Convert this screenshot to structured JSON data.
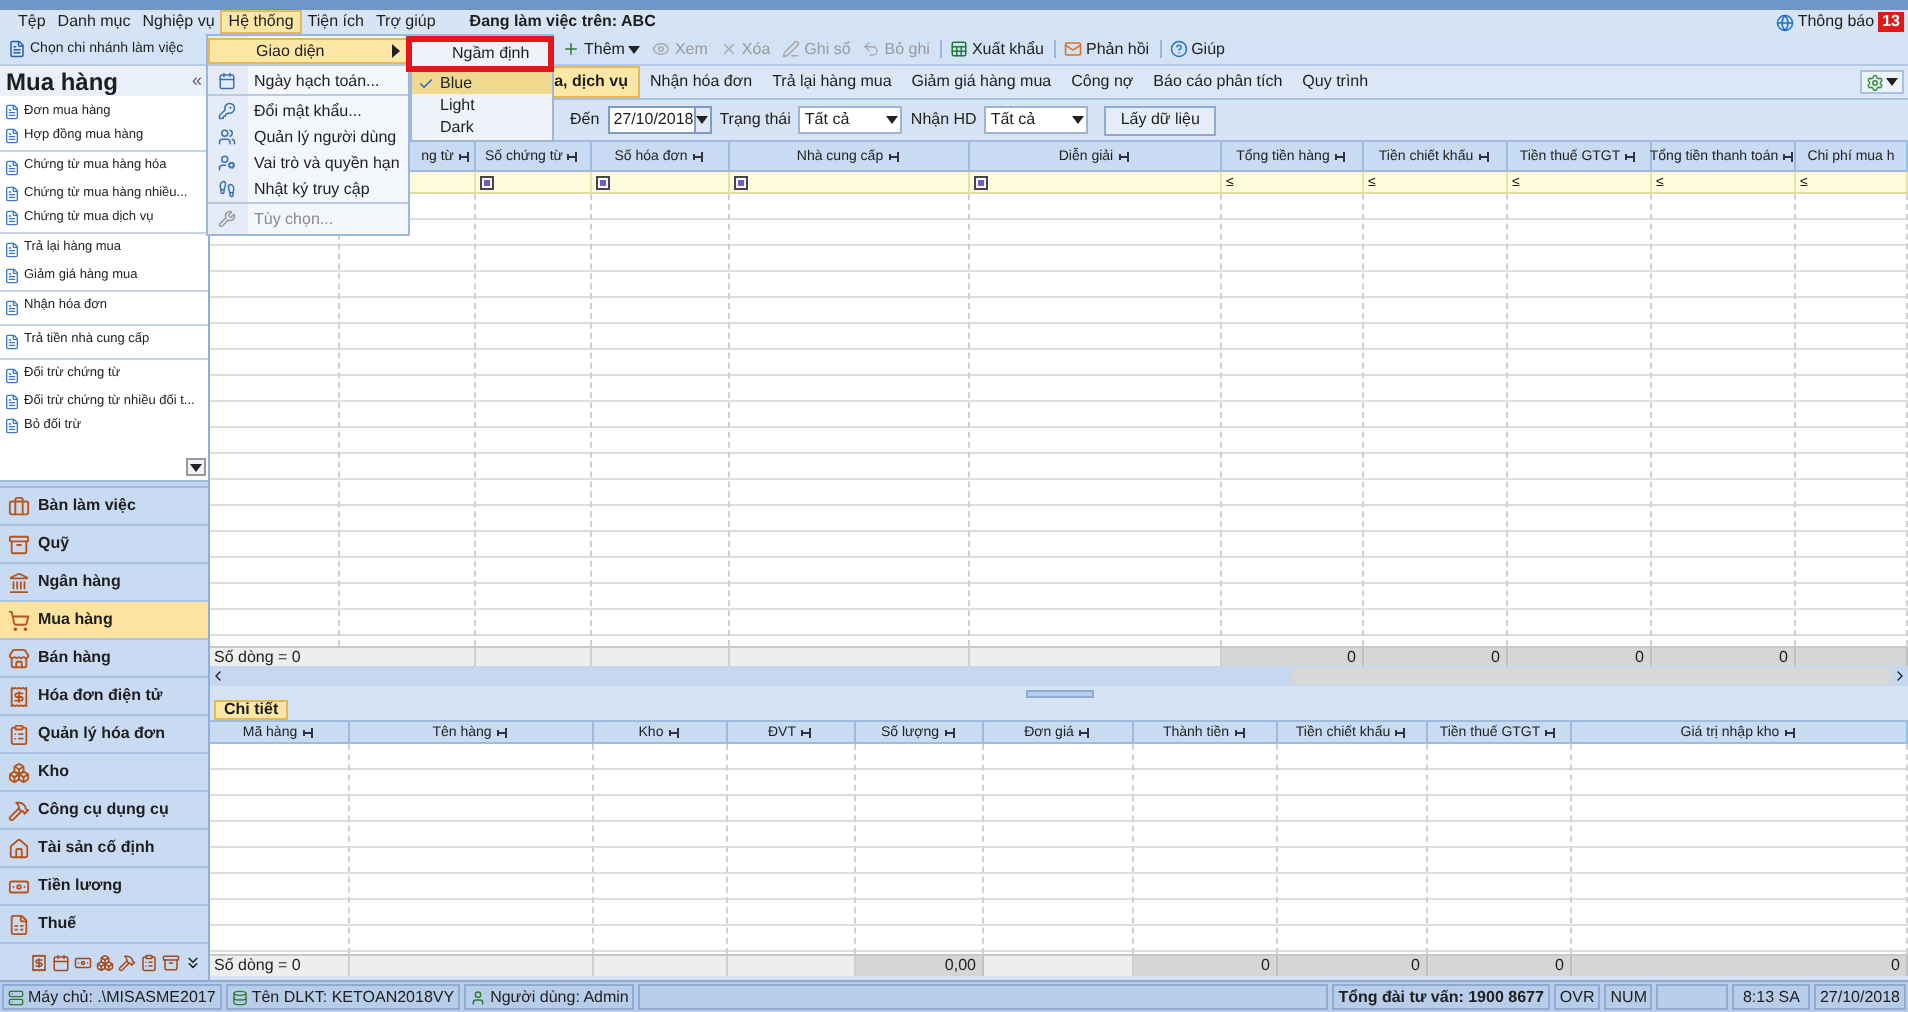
{
  "menu_bar": {
    "items": [
      {
        "label": "Tệp",
        "selected": false
      },
      {
        "label": "Danh mục",
        "selected": false
      },
      {
        "label": "Nghiệp vụ",
        "selected": false
      },
      {
        "label": "Hệ thống",
        "selected": true
      },
      {
        "label": "Tiện ích",
        "selected": false
      },
      {
        "label": "Trợ giúp",
        "selected": false
      }
    ],
    "workspace": "Đang làm việc trên: ABC",
    "notifications": {
      "label": "Thông báo",
      "count": "13"
    }
  },
  "toolbar": {
    "branch": {
      "label": "Chọn chi nhánh làm việc"
    },
    "items": [
      {
        "label": "Thêm",
        "disabled": false,
        "dropdown": true,
        "separator_before": false
      },
      {
        "label": "Xem",
        "disabled": true,
        "dropdown": false,
        "separator_before": false
      },
      {
        "label": "Xóa",
        "disabled": true,
        "dropdown": false,
        "separator_before": false
      },
      {
        "label": "Ghi sổ",
        "disabled": true,
        "dropdown": false,
        "separator_before": false
      },
      {
        "label": "Bỏ ghi",
        "disabled": true,
        "dropdown": false,
        "separator_before": false
      },
      {
        "label": "Xuất khẩu",
        "disabled": false,
        "dropdown": false,
        "separator_before": true
      },
      {
        "label": "Phản hồi",
        "disabled": false,
        "dropdown": false,
        "separator_before": true
      },
      {
        "label": "Giúp",
        "disabled": false,
        "dropdown": false,
        "separator_before": true
      }
    ]
  },
  "system_menu": {
    "items": [
      {
        "label": "Giao diện",
        "selected": true,
        "disabled": false,
        "submenu": true,
        "separator_before": false
      },
      {
        "label": "Ngày hạch toán...",
        "selected": false,
        "disabled": false,
        "submenu": false,
        "separator_before": true
      },
      {
        "label": "Đổi mật khẩu...",
        "selected": false,
        "disabled": false,
        "submenu": false,
        "separator_before": true
      },
      {
        "label": "Quản lý người dùng",
        "selected": false,
        "disabled": false,
        "submenu": false,
        "separator_before": false
      },
      {
        "label": "Vai trò và quyền hạn",
        "selected": false,
        "disabled": false,
        "submenu": false,
        "separator_before": false
      },
      {
        "label": "Nhật ký truy cập",
        "selected": false,
        "disabled": false,
        "submenu": false,
        "separator_before": false
      },
      {
        "label": "Tùy chọn...",
        "selected": false,
        "disabled": true,
        "submenu": false,
        "separator_before": true
      }
    ]
  },
  "theme_submenu": {
    "items": [
      {
        "label": "Ngầm định",
        "checked": false,
        "selected": false,
        "annotated": true
      },
      {
        "label": "Blue",
        "checked": true,
        "selected": true,
        "annotated": false
      },
      {
        "label": "Light",
        "checked": false,
        "selected": false,
        "annotated": false
      },
      {
        "label": "Dark",
        "checked": false,
        "selected": false,
        "annotated": false
      }
    ]
  },
  "sidebar": {
    "title": "Mua hàng",
    "collapse": "«",
    "items": [
      {
        "label": "Đơn mua hàng",
        "separator_before": false
      },
      {
        "label": "Hợp đồng mua hàng",
        "separator_before": false
      },
      {
        "label": "Chứng từ mua hàng hóa",
        "separator_before": true
      },
      {
        "label": "Chứng từ mua hàng nhiều...",
        "separator_before": false
      },
      {
        "label": "Chứng từ mua dịch vụ",
        "separator_before": false
      },
      {
        "label": "Trả lại hàng mua",
        "separator_before": true
      },
      {
        "label": "Giảm giá hàng mua",
        "separator_before": false
      },
      {
        "label": "Nhận hóa đơn",
        "separator_before": true
      },
      {
        "label": "Trả tiền nhà cung cấp",
        "separator_before": true
      },
      {
        "label": "Đối trừ chứng từ",
        "separator_before": true
      },
      {
        "label": "Đối trừ chứng từ nhiều đối t...",
        "separator_before": false
      },
      {
        "label": "Bỏ đối trừ",
        "separator_before": false
      }
    ],
    "modules": [
      {
        "label": "Bàn làm việc",
        "selected": false
      },
      {
        "label": "Quỹ",
        "selected": false
      },
      {
        "label": "Ngân hàng",
        "selected": false
      },
      {
        "label": "Mua hàng",
        "selected": true
      },
      {
        "label": "Bán hàng",
        "selected": false
      },
      {
        "label": "Hóa đơn điện tử",
        "selected": false
      },
      {
        "label": "Quản lý hóa đơn",
        "selected": false
      },
      {
        "label": "Kho",
        "selected": false
      },
      {
        "label": "Công cụ dụng cụ",
        "selected": false
      },
      {
        "label": "Tài sản cố định",
        "selected": false
      },
      {
        "label": "Tiền lương",
        "selected": false
      },
      {
        "label": "Thuế",
        "selected": false
      }
    ]
  },
  "tabs": [
    {
      "label": "a, dịch vụ",
      "selected": true
    },
    {
      "label": "Nhận hóa đơn",
      "selected": false
    },
    {
      "label": "Trả lại hàng mua",
      "selected": false
    },
    {
      "label": "Giảm giá hàng mua",
      "selected": false
    },
    {
      "label": "Công nợ",
      "selected": false
    },
    {
      "label": "Báo cáo phân tích",
      "selected": false
    },
    {
      "label": "Quy trình",
      "selected": false
    }
  ],
  "filters": {
    "fields": [
      {
        "label": "Đến",
        "kind": "date",
        "value": "27/10/2018"
      },
      {
        "label": "Trạng thái",
        "kind": "select",
        "value": "Tất cả"
      },
      {
        "label": "Nhận HD",
        "kind": "select",
        "value": "Tất cả"
      }
    ],
    "button": "Lấy dữ liệu"
  },
  "table": {
    "columns": [
      {
        "label": "ng từ"
      },
      {
        "label": "Số chứng từ",
        "filter": {
          "kind": "text"
        }
      },
      {
        "label": "Số hóa đơn",
        "filter": {
          "kind": "text"
        }
      },
      {
        "label": "Nhà cung cấp",
        "filter": {
          "kind": "text"
        }
      },
      {
        "label": "Diễn giải",
        "filter": {
          "kind": "text"
        }
      },
      {
        "label": "Tổng tiền hàng",
        "filter": {
          "kind": "number",
          "operator": "≤"
        },
        "total": "0"
      },
      {
        "label": "Tiền chiết khấu",
        "filter": {
          "kind": "number",
          "operator": "≤"
        },
        "total": "0"
      },
      {
        "label": "Tiền thuế GTGT",
        "filter": {
          "kind": "number",
          "operator": "≤"
        },
        "total": "0"
      },
      {
        "label": "Tổng tiền thanh toán",
        "filter": {
          "kind": "number",
          "operator": "≤"
        },
        "total": "0"
      },
      {
        "label": "Chi phí mua h",
        "filter": {
          "kind": "number",
          "operator": "≤"
        }
      }
    ],
    "row_count": "Số dòng = 0"
  },
  "detail": {
    "tabs": [
      {
        "label": "Chi tiết",
        "selected": true
      }
    ],
    "columns": [
      {
        "label": "Mã hàng"
      },
      {
        "label": "Tên hàng"
      },
      {
        "label": "Kho"
      },
      {
        "label": "ĐVT"
      },
      {
        "label": "Số lượng",
        "total": "0,00"
      },
      {
        "label": "Đơn giá"
      },
      {
        "label": "Thành tiền",
        "total": "0"
      },
      {
        "label": "Tiền chiết khấu",
        "total": "0"
      },
      {
        "label": "Tiền thuế GTGT",
        "total": "0"
      },
      {
        "label": "Giá trị nhập kho",
        "total": "0"
      }
    ],
    "row_count": "Số dòng = 0"
  },
  "status_bar": {
    "server": "Máy chủ: .\\MISASME2017",
    "database": "Tên DLKT: KETOAN2018VY",
    "user": "Người dùng: Admin",
    "hotline": "Tổng đài tư vấn: 1900 8677",
    "ovr": "OVR",
    "num": "NUM",
    "time": "8:13 SA",
    "date": "27/10/2018"
  }
}
